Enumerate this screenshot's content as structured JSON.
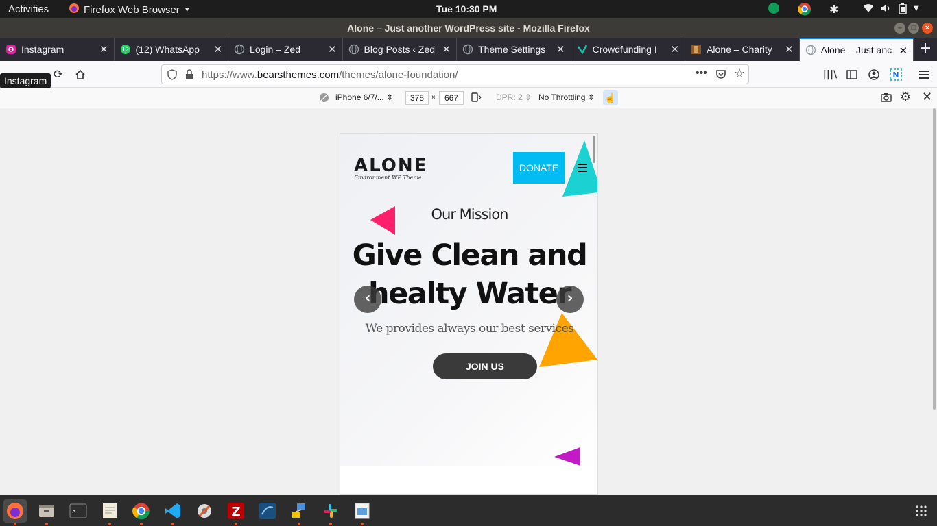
{
  "topbar": {
    "activities": "Activities",
    "app_name": "Firefox Web Browser",
    "clock": "Tue 10:30 PM"
  },
  "window": {
    "title": "Alone – Just another WordPress site - Mozilla Firefox"
  },
  "tabs": [
    {
      "label": "Instagram",
      "icon": "instagram-icon",
      "color": "#d6249f"
    },
    {
      "label": "(12) WhatsApp",
      "icon": "whatsapp-icon",
      "color": "#25d366",
      "badge": "12"
    },
    {
      "label": "Login – Zed",
      "icon": "globe-icon",
      "color": "#9aa0a6"
    },
    {
      "label": "Blog Posts ‹ Zed",
      "icon": "globe-icon",
      "color": "#9aa0a6"
    },
    {
      "label": "Theme Settings",
      "icon": "globe-icon",
      "color": "#9aa0a6"
    },
    {
      "label": "Crowdfunding I",
      "icon": "crowdfunding-icon",
      "color": "#16c1a8"
    },
    {
      "label": "Alone – Charity",
      "icon": "alone-charity-icon",
      "color": "#8b5a2b"
    },
    {
      "label": "Alone – Just anc",
      "icon": "globe-icon",
      "color": "#9aa0a6",
      "active": true
    }
  ],
  "tooltip": "Instagram",
  "urlbar": {
    "prefix": "https://www.",
    "domain": "bearsthemes.com",
    "path": "/themes/alone-foundation/"
  },
  "rdm": {
    "device": "iPhone 6/7/...",
    "width": "375",
    "times": "×",
    "height": "667",
    "dpr": "DPR: 2",
    "throttling": "No Throttling"
  },
  "site": {
    "logo": "ALONE",
    "logo_tagline": "Environment WP Theme",
    "donate": "DONATE",
    "mission": "Our Mission",
    "headline_line1": "Give Clean and",
    "headline_line2": "healty Water",
    "subtitle": "We provides always our best services",
    "join": "JOIN US",
    "prev": "‹",
    "next": "›"
  },
  "colors": {
    "accent_donate": "#00bcf2",
    "triangle_pink": "#ff1f6b",
    "triangle_cyan": "#1bd1d1",
    "triangle_orange": "#ffa400",
    "triangle_purple": "#c21bc6"
  },
  "dock": [
    "firefox-icon",
    "files-icon",
    "terminal-icon",
    "text-editor-icon",
    "chrome-icon",
    "vscode-icon",
    "settings-icon",
    "filezilla-icon",
    "mysql-workbench-icon",
    "network-icon",
    "slack-icon",
    "image-viewer-icon"
  ]
}
